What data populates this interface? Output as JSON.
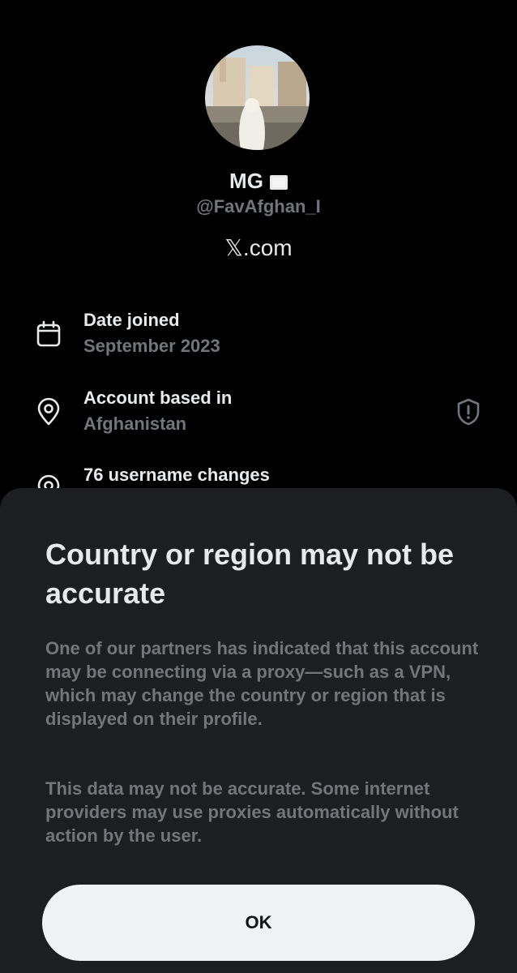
{
  "profile": {
    "name": "MG",
    "flag_icon": "white-flag-icon",
    "handle": "@FavAfghan_I",
    "site": "𝕏.com"
  },
  "info": [
    {
      "icon": "calendar-icon",
      "label": "Date joined",
      "value": "September 2023"
    },
    {
      "icon": "location-pin-icon",
      "label": "Account based in",
      "value": "Afghanistan",
      "alert_icon": "shield-alert-icon"
    },
    {
      "icon": "location-pin-icon",
      "label": "76 username changes",
      "value": ""
    }
  ],
  "sheet": {
    "title": "Country or region may not be accurate",
    "paragraph1": "One of our partners has indicated that this account may be connecting via a proxy—such as a VPN, which may change the country or region that is displayed on their profile.",
    "paragraph2": "This data may not be accurate. Some internet providers may use proxies automatically without action by the user.",
    "ok_label": "OK"
  },
  "colors": {
    "background": "#000000",
    "sheet": "#1d1e20",
    "text_primary": "#e7e9ea",
    "text_secondary": "#71767b",
    "button_bg": "#eff3f4"
  }
}
